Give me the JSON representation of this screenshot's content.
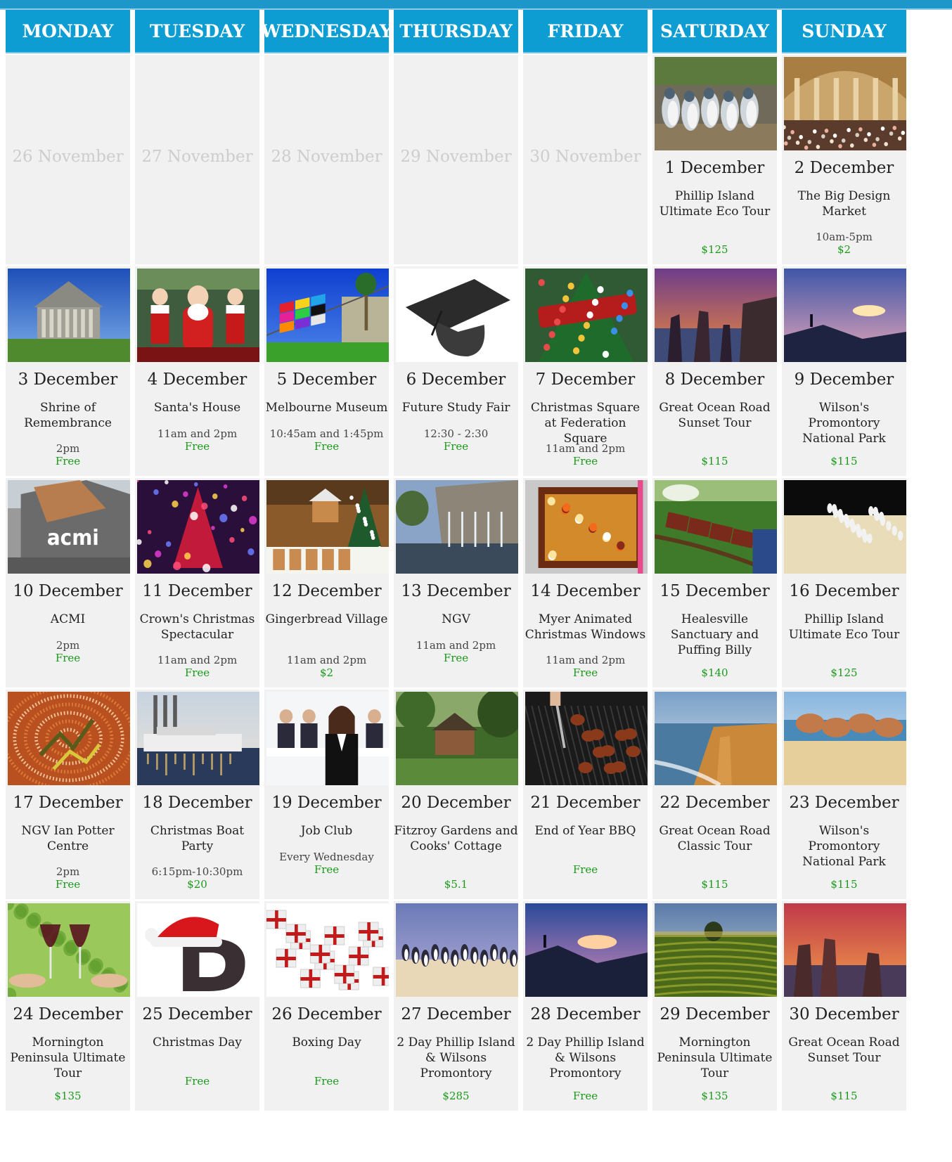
{
  "days": [
    "MONDAY",
    "TUESDAY",
    "WEDNESDAY",
    "THURSDAY",
    "FRIDAY",
    "SATURDAY",
    "SUNDAY"
  ],
  "weeks": [
    [
      {
        "date": "26 November",
        "faded": true
      },
      {
        "date": "27 November",
        "faded": true
      },
      {
        "date": "28 November",
        "faded": true
      },
      {
        "date": "29 November",
        "faded": true
      },
      {
        "date": "30 November",
        "faded": true
      },
      {
        "date": "1 December",
        "title": "Phillip Island Ultimate Eco Tour",
        "time": "",
        "price": "$125",
        "image": "penguins-photo"
      },
      {
        "date": "2 December",
        "title": "The Big Design Market",
        "time": "10am-5pm",
        "price": "$2",
        "image": "exhibition-hall-photo"
      }
    ],
    [
      {
        "date": "3 December",
        "title": "Shrine of Remembrance",
        "time": "2pm",
        "price": "Free",
        "image": "shrine-photo"
      },
      {
        "date": "4 December",
        "title": "Santa's House",
        "time": "11am and 2pm",
        "price": "Free",
        "image": "santa-photo"
      },
      {
        "date": "5 December",
        "title": "Melbourne Museum",
        "time": "10:45am and 1:45pm",
        "price": "Free",
        "image": "museum-photo"
      },
      {
        "date": "6 December",
        "title": "Future Study Fair",
        "time": "12:30 - 2:30",
        "price": "Free",
        "image": "graduation-cap-photo"
      },
      {
        "date": "7 December",
        "title": "Christmas Square at Federation Square",
        "time": "11am and 2pm",
        "price": "Free",
        "image": "christmas-tree-photo"
      },
      {
        "date": "8 December",
        "title": "Great Ocean Road Sunset Tour",
        "time": "",
        "price": "$115",
        "image": "apostles-sunset-photo"
      },
      {
        "date": "9 December",
        "title": "Wilson's Promontory National Park",
        "time": "",
        "price": "$115",
        "image": "promontory-sunset-photo"
      }
    ],
    [
      {
        "date": "10 December",
        "title": "ACMI",
        "time": "2pm",
        "price": "Free",
        "image": "acmi-photo"
      },
      {
        "date": "11 December",
        "title": "Crown's Christmas Spectacular",
        "time": "11am and 2pm",
        "price": "Free",
        "image": "crown-tree-photo"
      },
      {
        "date": "12 December",
        "title": "Gingerbread Village",
        "time": "11am and 2pm",
        "price": "$2",
        "image": "gingerbread-photo"
      },
      {
        "date": "13 December",
        "title": "NGV",
        "time": "11am and 2pm",
        "price": "Free",
        "image": "ngv-photo"
      },
      {
        "date": "14 December",
        "title": "Myer Animated Christmas Windows",
        "time": "11am and 2pm",
        "price": "Free",
        "image": "myer-window-photo"
      },
      {
        "date": "15 December",
        "title": "Healesville Sanctuary and Puffing Billy",
        "time": "",
        "price": "$140",
        "image": "steam-train-photo"
      },
      {
        "date": "16 December",
        "title": "Phillip Island Ultimate Eco Tour",
        "time": "",
        "price": "$125",
        "image": "penguin-parade-photo"
      }
    ],
    [
      {
        "date": "17 December",
        "title": "NGV Ian Potter Centre",
        "time": "2pm",
        "price": "Free",
        "image": "aboriginal-art-photo"
      },
      {
        "date": "18 December",
        "title": "Christmas Boat Party",
        "time": "6:15pm-10:30pm",
        "price": "$20",
        "image": "boat-photo"
      },
      {
        "date": "19 December",
        "title": "Job Club",
        "time": "Every Wednesday",
        "price": "Free",
        "image": "job-club-photo"
      },
      {
        "date": "20 December",
        "title": "Fitzroy Gardens and Cooks' Cottage",
        "time": "",
        "price": "$5.1",
        "image": "cottage-photo"
      },
      {
        "date": "21 December",
        "title": "End of Year BBQ",
        "time": "",
        "price": "Free",
        "image": "bbq-photo"
      },
      {
        "date": "22 December",
        "title": "Great Ocean Road Classic Tour",
        "time": "",
        "price": "$115",
        "image": "coastline-photo"
      },
      {
        "date": "23 December",
        "title": "Wilson's Promontory National Park",
        "time": "",
        "price": "$115",
        "image": "beach-rocks-photo"
      }
    ],
    [
      {
        "date": "24 December",
        "title": "Mornington Peninsula Ultimate Tour",
        "time": "",
        "price": "$135",
        "image": "wine-glasses-photo"
      },
      {
        "date": "25 December",
        "title": "Christmas Day",
        "time": "",
        "price": "Free",
        "image": "santa-hat-logo"
      },
      {
        "date": "26 December",
        "title": "Boxing Day",
        "time": "",
        "price": "Free",
        "image": "gift-boxes-photo"
      },
      {
        "date": "27 December",
        "title": "2 Day Phillip Island & Wilsons Promontory",
        "time": "",
        "price": "$285",
        "image": "penguins-beach-photo"
      },
      {
        "date": "28 December",
        "title": "2 Day Phillip Island & Wilsons Promontory",
        "time": "",
        "price": "Free",
        "image": "hill-sunset-photo"
      },
      {
        "date": "29 December",
        "title": "Mornington Peninsula Ultimate Tour",
        "time": "",
        "price": "$135",
        "image": "vineyard-photo"
      },
      {
        "date": "30 December",
        "title": "Great Ocean Road Sunset Tour",
        "time": "",
        "price": "$115",
        "image": "apostles-dusk-photo"
      }
    ]
  ]
}
